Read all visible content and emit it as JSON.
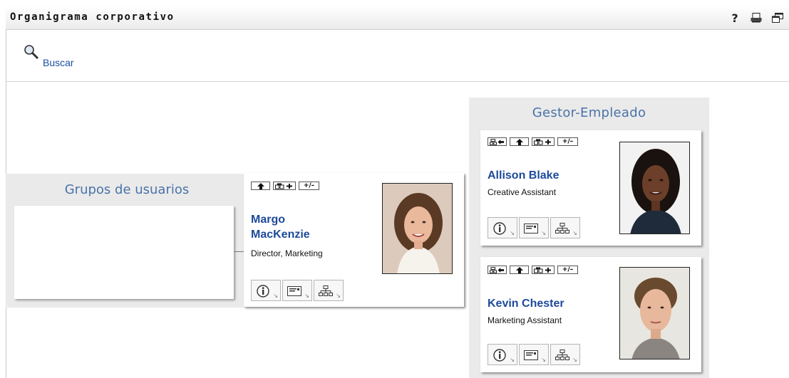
{
  "header": {
    "title": "Organigrama corporativo",
    "icons": [
      "help-icon",
      "print-icon",
      "new-window-icon"
    ],
    "help_glyph": "?"
  },
  "search": {
    "label": "Buscar",
    "icon": "magnifier-icon"
  },
  "groups_panel": {
    "title": "Grupos de usuarios"
  },
  "manager_panel": {
    "title": "Gestor-Empleado"
  },
  "toolbar_glyphs": {
    "to_manager": "⬅",
    "up": "🡅",
    "expand": "+",
    "toggle": "+/–"
  },
  "focus_person": {
    "name_line1": "Margo",
    "name_line2": "MacKenzie",
    "title": "Director, Marketing"
  },
  "reports": [
    {
      "name": "Allison Blake",
      "title": "Creative Assistant"
    },
    {
      "name": "Kevin Chester",
      "title": "Marketing Assistant"
    }
  ],
  "card_actions": [
    "info-icon",
    "email-icon",
    "org-chart-icon"
  ],
  "colors": {
    "link": "#1d4a9a",
    "panel_title": "#4a73a8",
    "panel_bg": "#eaeaea"
  }
}
